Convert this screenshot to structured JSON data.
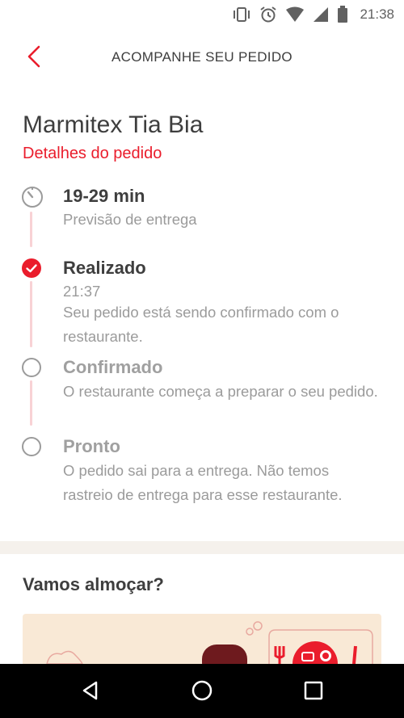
{
  "status_bar": {
    "time": "21:38",
    "icons": [
      "vibrate-icon",
      "alarm-icon",
      "wifi-icon",
      "signal-icon",
      "battery-icon"
    ]
  },
  "header": {
    "title": "ACOMPANHE SEU PEDIDO",
    "back_icon": "chevron-left-icon"
  },
  "order": {
    "store_name": "Marmitex Tia Bia",
    "details_link": "Detalhes do pedido"
  },
  "eta": {
    "time_range": "19-29 min",
    "label": "Previsão de entrega"
  },
  "steps": [
    {
      "title": "Realizado",
      "time": "21:37",
      "description": "Seu pedido está sendo confirmado com o restaurante.",
      "status": "done"
    },
    {
      "title": "Confirmado",
      "description": "O restaurante começa a preparar o seu pedido.",
      "status": "pending"
    },
    {
      "title": "Pronto",
      "description": "O pedido sai para a entrega. Não temos rastreio de entrega para esse restaurante.",
      "status": "pending"
    }
  ],
  "promo": {
    "title": "Vamos almoçar?"
  },
  "nav_bar": {
    "icons": [
      "back-triangle-icon",
      "home-circle-icon",
      "recents-square-icon"
    ]
  },
  "colors": {
    "accent": "#ea1d2c",
    "timeline_line": "#f8d2d5",
    "text_dark": "#3e3e3e",
    "text_muted": "#9b9b9b",
    "pending_title": "#a0a0a0",
    "divider": "#f5f1ec"
  }
}
